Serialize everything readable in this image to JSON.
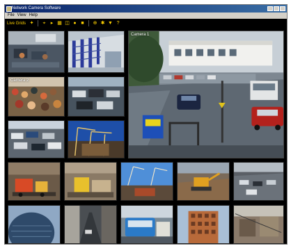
{
  "window": {
    "title": "Network Camera Software",
    "menu": [
      "File",
      "View",
      "Help"
    ]
  },
  "toolbar": {
    "label": "Live Grids",
    "icons": [
      "pin-icon",
      "camera-icon",
      "play-icon",
      "grid-icon",
      "layout-icon",
      "record-icon",
      "stop-icon",
      "zoom-icon",
      "settings-icon",
      "alert-icon",
      "help-icon"
    ]
  },
  "cameras": {
    "featured_label": "Camera 1",
    "tile2_label": "Camera 2"
  },
  "colors": {
    "titlebar": "#0a246a",
    "toolbar_accent": "#ffd200",
    "background": "#000000"
  }
}
